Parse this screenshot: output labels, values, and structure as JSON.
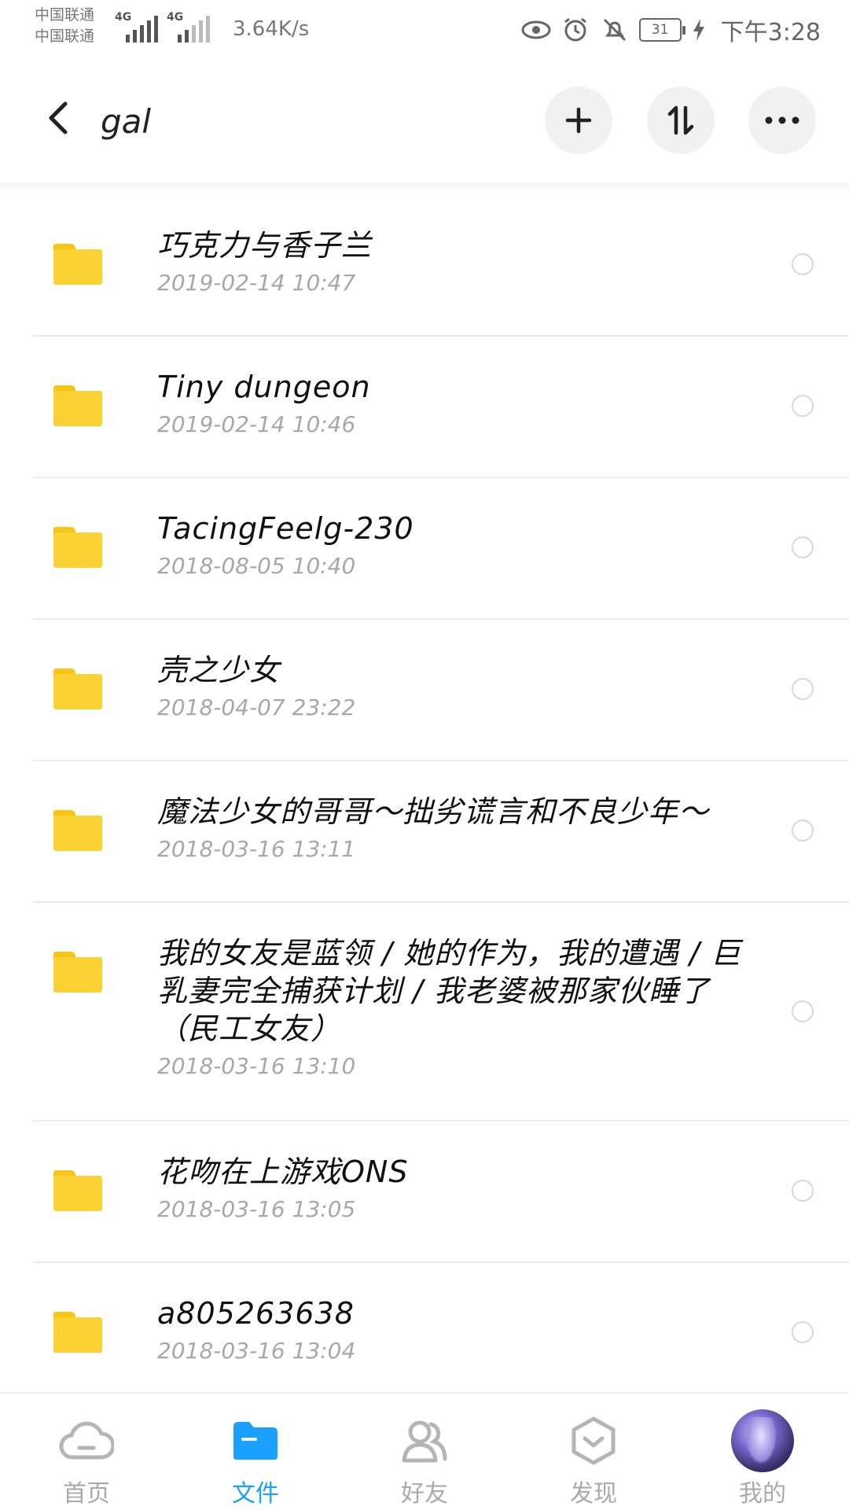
{
  "status_bar": {
    "carrier_1": "中国联通",
    "carrier_2": "中国联通",
    "signal_1": "4G",
    "signal_2": "4G",
    "net_speed": "3.64K/s",
    "battery": "31",
    "time": "下午3:28"
  },
  "header": {
    "title": "gal"
  },
  "files": [
    {
      "name": "巧克力与香子兰",
      "date": "2019-02-14  10:47"
    },
    {
      "name": "Tiny dungeon",
      "date": "2019-02-14  10:46"
    },
    {
      "name": "TacingFeelg-230",
      "date": "2018-08-05  10:40"
    },
    {
      "name": "壳之少女",
      "date": "2018-04-07  23:22"
    },
    {
      "name": "魔法少女的哥哥～拙劣谎言和不良少年～",
      "date": "2018-03-16  13:11"
    },
    {
      "name": "我的女友是蓝领 / 她的作为，我的遭遇 / 巨乳妻完全捕获计划 / 我老婆被那家伙睡了（民工女友）",
      "date": "2018-03-16  13:10"
    },
    {
      "name": "花吻在上游戏ONS",
      "date": "2018-03-16  13:05"
    },
    {
      "name": "a805263638",
      "date": "2018-03-16  13:04"
    }
  ],
  "bottom_nav": {
    "home": "首页",
    "files": "文件",
    "friends": "好友",
    "discover": "发现",
    "me": "我的"
  },
  "colors": {
    "accent": "#1aa0ff",
    "folder": "#fbd134",
    "inactive": "#aaaaaa"
  }
}
